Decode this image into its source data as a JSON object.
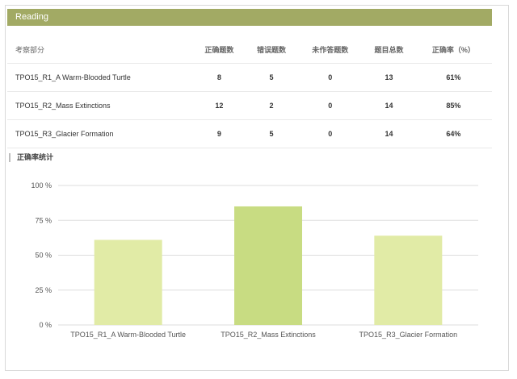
{
  "section": {
    "title": "Reading"
  },
  "table": {
    "headers": [
      "考察部分",
      "正确题数",
      "错误题数",
      "未作答题数",
      "题目总数",
      "正确率（%）"
    ],
    "rows": [
      [
        "TPO15_R1_A Warm-Blooded Turtle",
        "8",
        "5",
        "0",
        "13",
        "61%"
      ],
      [
        "TPO15_R2_Mass Extinctions",
        "12",
        "2",
        "0",
        "14",
        "85%"
      ],
      [
        "TPO15_R3_Glacier Formation",
        "9",
        "5",
        "0",
        "14",
        "64%"
      ]
    ]
  },
  "chart_title": "正确率统计",
  "chart_data": {
    "type": "bar",
    "categories": [
      "TPO15_R1_A Warm-Blooded Turtle",
      "TPO15_R2_Mass Extinctions",
      "TPO15_R3_Glacier Formation"
    ],
    "values": [
      61,
      85,
      64
    ],
    "ylim": [
      0,
      100
    ],
    "yticks": [
      0,
      25,
      50,
      75,
      100
    ],
    "ytick_labels": [
      "0 %",
      "25 %",
      "50 %",
      "75 %",
      "100 %"
    ],
    "grid": true,
    "colors": [
      "#e1eba6",
      "#c8dc82",
      "#e1eba6"
    ]
  },
  "colors": {
    "header_bg": "#a2aa64",
    "grid": "#dddddd"
  }
}
